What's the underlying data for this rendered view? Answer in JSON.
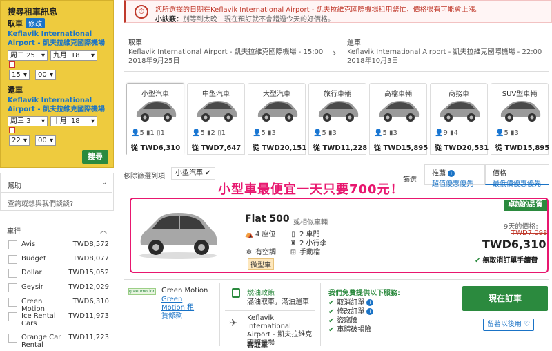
{
  "search": {
    "title": "搜尋租車訊息",
    "pickup_label": "取車",
    "modify": "修改",
    "pickup_location": "Keflavik International Airport - 凱夫拉維克國際機場",
    "pickup_day": "二 25",
    "pickup_day_prefix": "周",
    "pickup_month": "九月 '18",
    "pickup_hour": "15",
    "pickup_minute": "00",
    "return_label": "還車",
    "return_location": "Keflavik International Airport - 凱夫拉維克國際機場",
    "return_day": "三 3",
    "return_day_prefix": "周",
    "return_month": "十月 '18",
    "return_hour": "22",
    "return_minute": "00",
    "search_button": "搜尋"
  },
  "help": {
    "title": "幫助",
    "link": "查詢或想與我們談談?"
  },
  "company_filter": {
    "title": "車行",
    "items": [
      {
        "name": "Avis",
        "price": "TWD8,572"
      },
      {
        "name": "Budget",
        "price": "TWD8,077"
      },
      {
        "name": "Dollar",
        "price": "TWD15,052"
      },
      {
        "name": "Geysir",
        "price": "TWD12,029"
      },
      {
        "name": "Green Motion",
        "price": "TWD6,310"
      },
      {
        "name": "Ice Rental Cars",
        "price": "TWD11,973"
      },
      {
        "name": "Orange Car Rental",
        "price": "TWD11,223"
      }
    ]
  },
  "alert": {
    "line1": "您所選擇的日期在Keflavik International Airport - 凱夫拉維克國際機場租用緊忙，價格很有可能會上漲。",
    "line2_bold": "小訣竅：",
    "line2": "別等到太晚！現在預訂就不會錯過今天的好價格。"
  },
  "trip": {
    "pickup_label": "取車",
    "pickup_text": "Keflavik International Airport - 凱夫拉維克國際機場 - 15:00 2018年9月25日",
    "return_label": "還車",
    "return_text": "Keflavik International Airport - 凱夫拉維克國際機場 - 22:00 2018年10月3日"
  },
  "car_tabs": [
    {
      "label": "小型汽車",
      "seats": "5",
      "bags_l": "1",
      "bags_s": "1",
      "price": "從 TWD6,310"
    },
    {
      "label": "中型汽車",
      "seats": "5",
      "bags_l": "2",
      "bags_s": "1",
      "price": "從 TWD7,647"
    },
    {
      "label": "大型汽車",
      "seats": "5",
      "bags_l": "3",
      "bags_s": "",
      "price": "從 TWD20,151"
    },
    {
      "label": "旅行車輛",
      "seats": "5",
      "bags_l": "3",
      "bags_s": "",
      "price": "從 TWD11,228"
    },
    {
      "label": "高檔車輛",
      "seats": "5",
      "bags_l": "3",
      "bags_s": "",
      "price": "從 TWD15,895"
    },
    {
      "label": "商務車",
      "seats": "9",
      "bags_l": "4",
      "bags_s": "",
      "price": "從 TWD20,531"
    },
    {
      "label": "SUV型車輛",
      "seats": "5",
      "bags_l": "3",
      "bags_s": "",
      "price": "從 TWD15,895"
    }
  ],
  "filter_row": {
    "remove_filter": "移除篩選列項",
    "chip": "小型汽車 ✔",
    "sort_label": "篩選",
    "sort_recommended": "推薦",
    "sort_recommended_sub": "超值優惠優先",
    "sort_price": "價格",
    "sort_price_sub": "最低價優惠優先"
  },
  "promo_text": "小型車最便宜一天只要700元！",
  "result": {
    "car_name": "Fiat 500",
    "or_similar": "或相似車輛",
    "seats": "4 座位",
    "doors": "2 車門",
    "luggage": "2 小行李",
    "aircon": "有空調",
    "transmission": "手動檔",
    "class_badge": "微型車",
    "best_badge": "卓越的品質",
    "days_price": "9天的價格:",
    "old_price": "TWD7,098",
    "new_price": "TWD6,310",
    "free_cancel": "無取消訂單手續費"
  },
  "detail": {
    "supplier_logo": "greenmotion",
    "supplier": "Green Motion",
    "supplier_link": "Green Motion 租賃條款",
    "fuel_title": "燃油政策",
    "fuel_desc": "滿油取車，滿油還車",
    "airport": "Keflavik International Airport - 凱夫拉維克國際機場",
    "pickup_type": "客取車",
    "services_title": "我們免費提供以下服務:",
    "services": [
      "取消訂單",
      "修改訂單",
      "盜竊險",
      "車體破損險"
    ],
    "book_button": "現在訂車",
    "save_button": "留著以後用"
  },
  "colors": {
    "accent_green": "#2b8a3e",
    "link_blue": "#1a73c6",
    "promo_pink": "#e8176f",
    "panel_yellow": "#eecb3e"
  }
}
